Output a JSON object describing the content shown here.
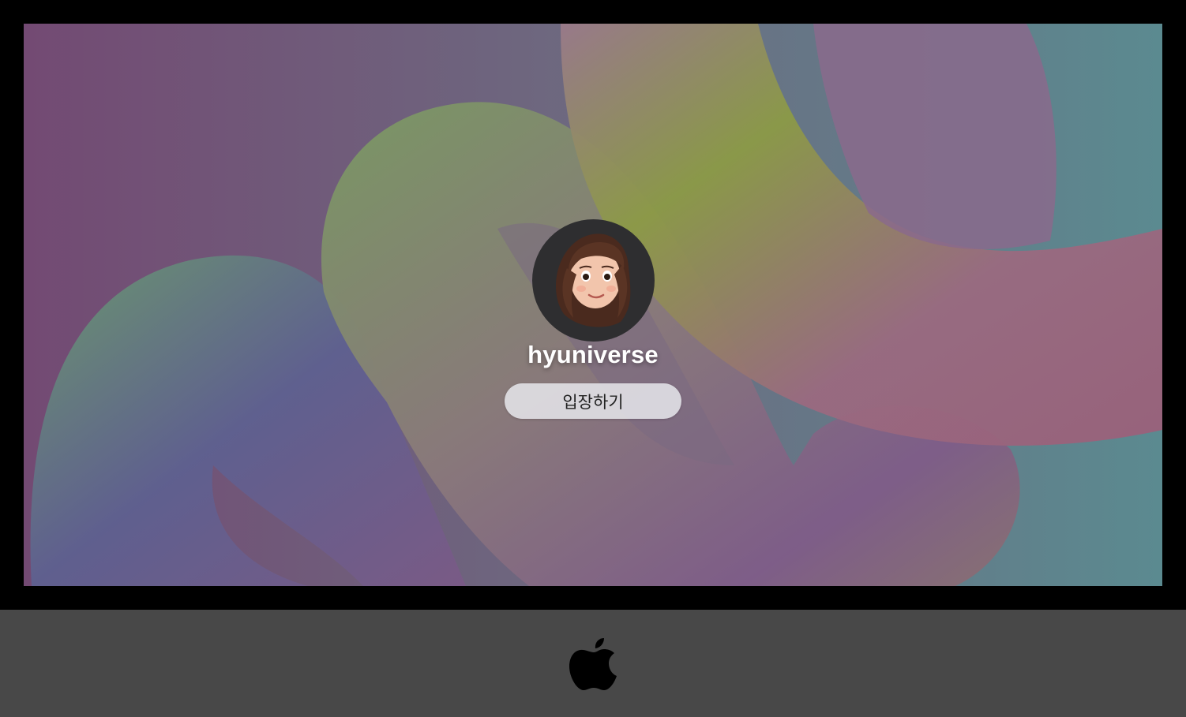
{
  "login": {
    "username": "hyuniverse",
    "enter_label": "입장하기"
  },
  "icons": {
    "avatar": "memoji-avatar",
    "logo": "apple-logo-icon"
  },
  "colors": {
    "bezel": "#000000",
    "chin": "#484848",
    "avatar_bg": "#2e2e30",
    "button_bg": "#e4e4e8"
  }
}
